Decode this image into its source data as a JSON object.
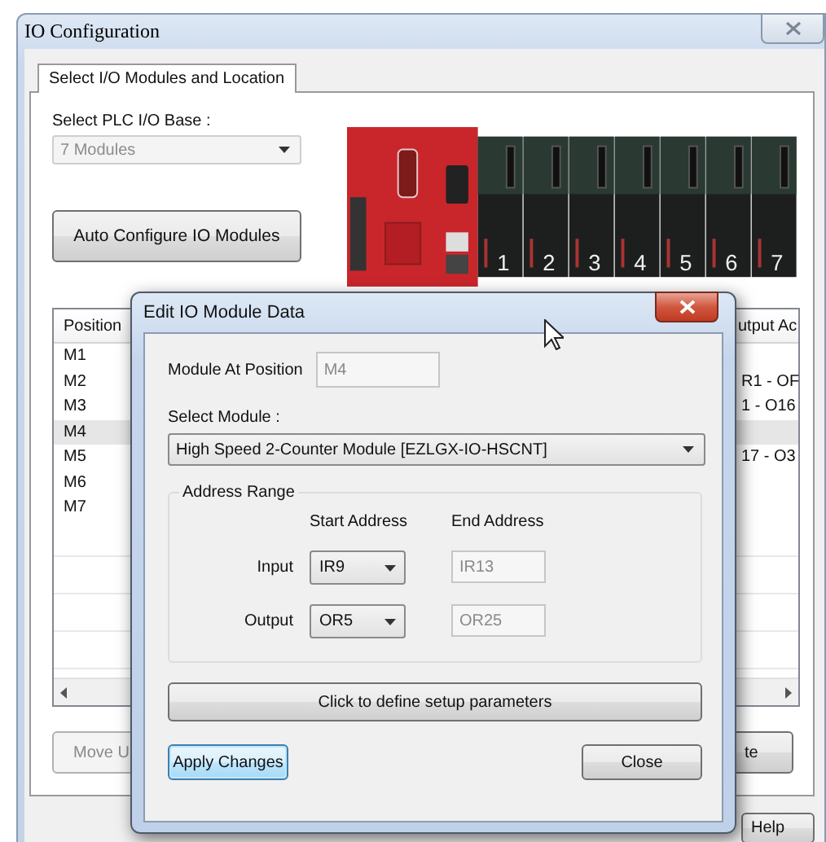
{
  "window": {
    "title": "IO Configuration"
  },
  "tabs": [
    {
      "label": "Select I/O Modules and Location",
      "selected": true
    }
  ],
  "plc_base": {
    "label": "Select PLC I/O Base :",
    "value": "7 Modules",
    "disabled": true
  },
  "auto_configure_button": "Auto Configure IO Modules",
  "rack": {
    "slots": [
      "1",
      "2",
      "3",
      "4",
      "5",
      "6",
      "7"
    ]
  },
  "table": {
    "columns": [
      "Position",
      "utput Ac"
    ],
    "rows": [
      {
        "cells": [
          "M1"
        ],
        "selected": false
      },
      {
        "cells": [
          "M2",
          "R1 - OF"
        ],
        "selected": false
      },
      {
        "cells": [
          "M3",
          "1 - O16"
        ],
        "selected": false
      },
      {
        "cells": [
          "M4"
        ],
        "selected": true
      },
      {
        "cells": [
          "M5",
          "17 - O3"
        ],
        "selected": false
      },
      {
        "cells": [
          "M6"
        ],
        "selected": false
      },
      {
        "cells": [
          "M7"
        ],
        "selected": false
      }
    ]
  },
  "buttons": [
    {
      "label": "Move U",
      "disabled": true
    },
    {
      "label": "te",
      "disabled": false
    }
  ],
  "help_button": "Help",
  "dialog": {
    "title": "Edit IO Module Data",
    "module_position": {
      "label": "Module At Position",
      "value": "M4",
      "disabled": true
    },
    "select_module": {
      "label": "Select Module :",
      "value": "High Speed 2-Counter Module [EZLGX-IO-HSCNT]"
    },
    "address_range": {
      "title": "Address Range",
      "columns": [
        "Start Address",
        "End Address"
      ],
      "rows": [
        {
          "label": "Input",
          "start": "IR9",
          "end": "IR13"
        },
        {
          "label": "Output",
          "start": "OR5",
          "end": "OR25"
        }
      ]
    },
    "setup_button": "Click to define setup parameters",
    "buttons": [
      {
        "label": "Apply Changes",
        "focused": true
      },
      {
        "label": "Close",
        "focused": false
      }
    ]
  }
}
